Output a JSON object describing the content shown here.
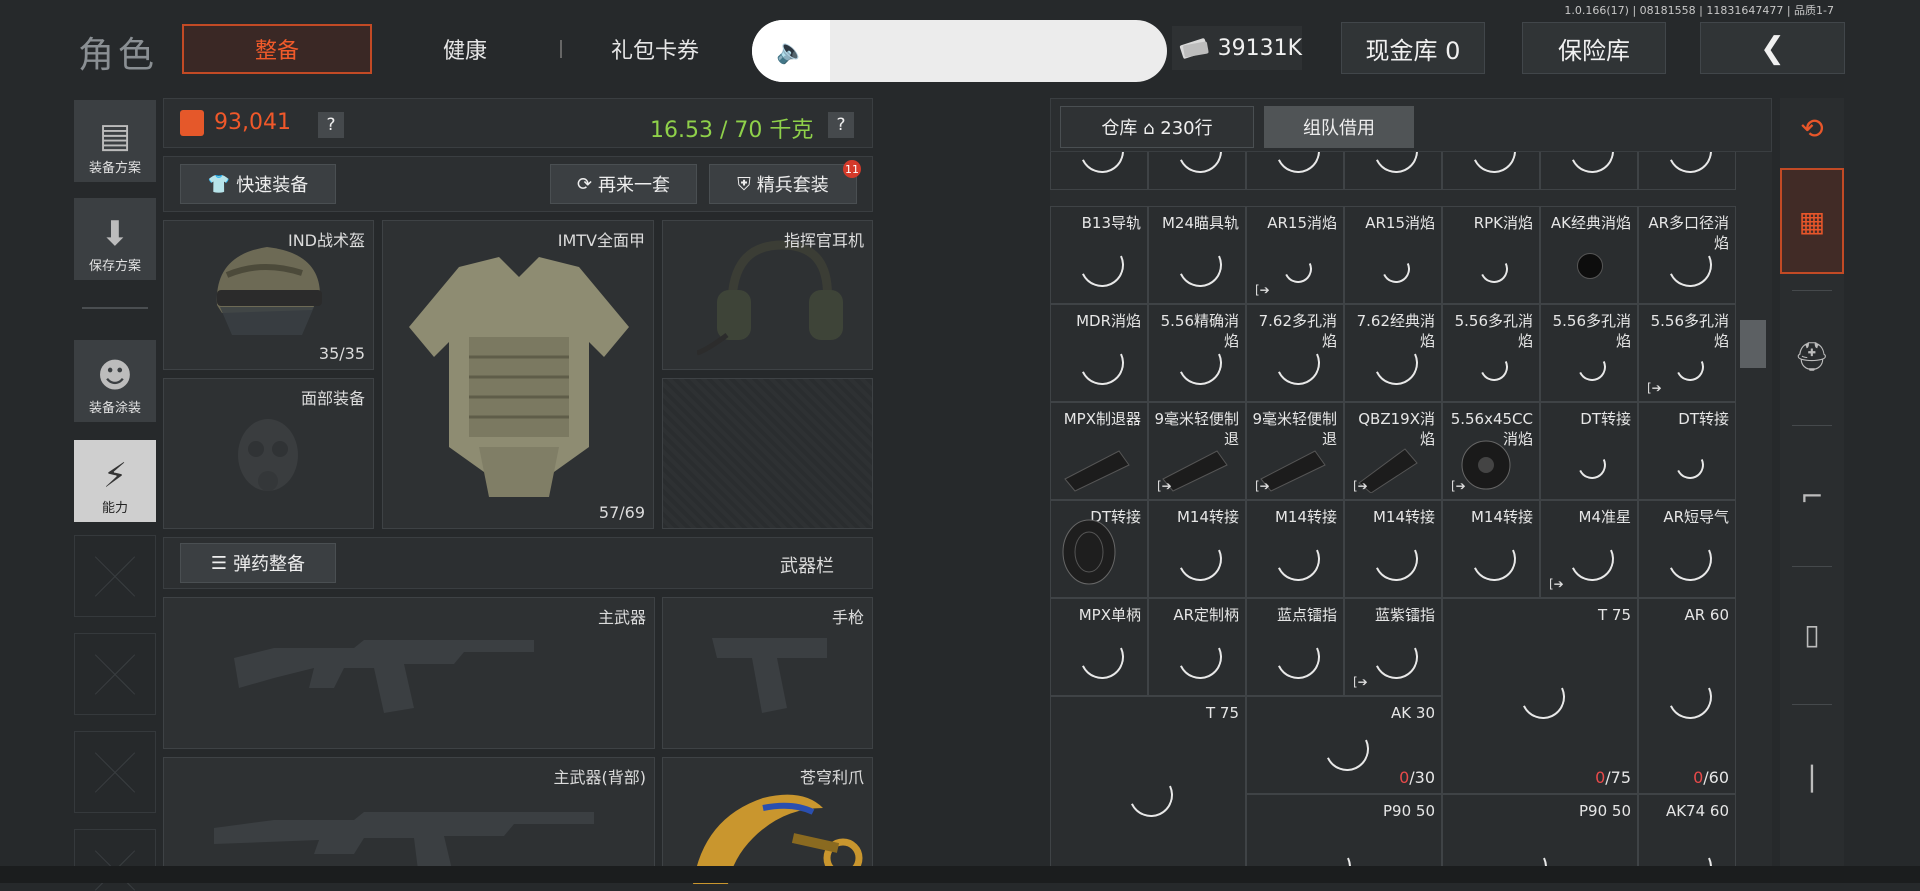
{
  "version": "1.0.166(17) | 08181558 | 11831647477 | 品质1-7",
  "header": {
    "title": "角色",
    "tabs": [
      "整备",
      "健康",
      "礼包卡券"
    ],
    "money": "39131K",
    "cash_vault": "现金库 0",
    "insurance": "保险库",
    "back": "❮"
  },
  "sidebar": {
    "items": [
      {
        "label": "装备方案",
        "icon": "vest-icon"
      },
      {
        "label": "保存方案",
        "icon": "download-icon"
      },
      {
        "label": "装备涂装",
        "icon": "soldier-icon"
      },
      {
        "label": "能力",
        "icon": "ability-icon"
      }
    ]
  },
  "loadout": {
    "value": "93,041",
    "weight": "16.53 / 70 千克",
    "help": "?",
    "quick_equip": "快速装备",
    "again_set": "再来一套",
    "elite_set": "精兵套装",
    "elite_badge": "11",
    "helmet": {
      "name": "IND战术盔",
      "count": "35/35"
    },
    "face": {
      "name": "面部装备"
    },
    "armor": {
      "name": "IMTV全面甲",
      "count": "57/69"
    },
    "headset": {
      "name": "指挥官耳机"
    },
    "ammo_btn": "弹药整备",
    "weapon_slot_title": "武器栏",
    "primary": "主武器",
    "pistol": "手枪",
    "primary_back": "主武器(背部)",
    "melee": "苍穹利爪"
  },
  "warehouse": {
    "tab_store": "仓库 ⌂ 230行",
    "tab_team": "组队借用",
    "rows": [
      [
        "",
        "",
        "",
        "",
        "",
        "",
        ""
      ],
      [
        "B13导轨",
        "M24瞄具轨",
        "AR15消焰",
        "AR15消焰",
        "RPK消焰",
        "AK经典消焰",
        "AR多口径消焰"
      ],
      [
        "MDR消焰",
        "5.56精确消焰",
        "7.62多孔消焰",
        "7.62经典消焰",
        "5.56多孔消焰",
        "5.56多孔消焰",
        "5.56多孔消焰"
      ],
      [
        "MPX制退器",
        "9毫米轻便制退",
        "9毫米轻便制退",
        "QBZ19X消焰",
        "5.56x45CC消焰",
        "DT转接",
        "DT转接"
      ],
      [
        "DT转接",
        "M14转接",
        "M14转接",
        "M14转接",
        "M14转接",
        "M4准星",
        "AR短导气"
      ],
      [
        "MPX单柄",
        "AR定制柄",
        "蓝点镭指",
        "蓝紫镭指"
      ]
    ],
    "big_items": [
      {
        "name": "T 75"
      },
      {
        "name": "AR 60"
      },
      {
        "name": "T 75"
      },
      {
        "name": "AK 30",
        "count_red": "0",
        "count": "/30"
      },
      {
        "name": "",
        "count_red": "0",
        "count": "/75"
      },
      {
        "name": "",
        "count_red": "0",
        "count": "/60"
      },
      {
        "name": "P90 50"
      },
      {
        "name": "P90 50"
      },
      {
        "name": "AK74 60"
      }
    ]
  },
  "categories": [
    "sort-icon",
    "all-icon",
    "helmet-icon",
    "rifle-icon",
    "magazine-icon",
    "bullet-icon"
  ],
  "colors": {
    "accent": "#e8562a",
    "weight_ok": "#8fd14a",
    "count_empty": "#e84a4a"
  }
}
